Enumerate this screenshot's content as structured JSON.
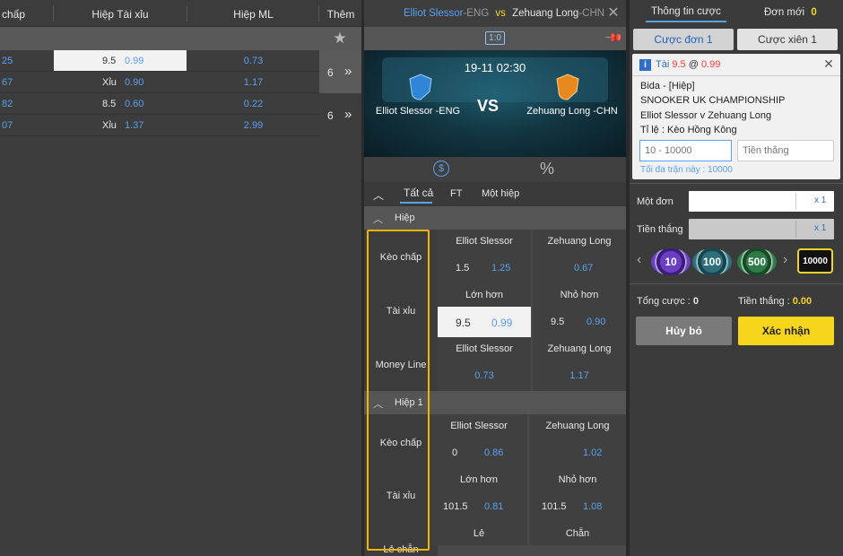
{
  "left": {
    "headers": {
      "col1": "chấp",
      "col2": "Hiệp Tài xỉu",
      "col3": "Hiệp ML",
      "col4": "Thêm"
    },
    "rows": [
      {
        "c1": "25",
        "c2a": "9.5",
        "c2b": "0.99",
        "c3": "0.73"
      },
      {
        "c1": "67",
        "c2a": "Xỉu",
        "c2b": "0.90",
        "c3": "1.17"
      },
      {
        "c1": "82",
        "c2a": "8.5",
        "c2b": "0.60",
        "c3": "0.22"
      },
      {
        "c1": "07",
        "c2a": "Xỉu",
        "c2b": "1.37",
        "c3": "2.99"
      }
    ],
    "more_count_1": "6",
    "more_count_2": "6",
    "more_arrow": "»"
  },
  "match": {
    "team1": "Elliot Slessor",
    "team1_country": "-ENG",
    "vs": "vs",
    "team2": "Zehuang Long",
    "team2_country": "-CHN",
    "score_badge": "1:0",
    "datetime": "19-11 02:30",
    "vs_big": "VS",
    "tabs": [
      "Tất cả",
      "FT",
      "Một hiệp"
    ],
    "section1": "Hiệp",
    "section2": "Hiệp 1"
  },
  "market": {
    "labels": [
      "Kèo chấp",
      "Tài xỉu",
      "Money Line",
      "Kèo chấp",
      "Tài xỉu",
      "Lẻ chẵn"
    ],
    "h_hdr1": "Elliot Slessor",
    "h_hdr2": "Zehuang Long",
    "h_a1": "1.5",
    "h_a2": "1.25",
    "h_b": "0.67",
    "ou_hdr1": "Lớn hơn",
    "ou_hdr2": "Nhỏ hơn",
    "ou_a1": "9.5",
    "ou_a2": "0.99",
    "ou_b1": "9.5",
    "ou_b2": "0.90",
    "ml_hdr1": "Elliot Slessor",
    "ml_hdr2": "Zehuang Long",
    "ml_a": "0.73",
    "ml_b": "1.17",
    "h1_hdr1": "Elliot Slessor",
    "h1_hdr2": "Zehuang Long",
    "h1_a1": "0",
    "h1_a2": "0.86",
    "h1_b": "1.02",
    "h1ou_hdr1": "Lớn hơn",
    "h1ou_hdr2": "Nhỏ hơn",
    "h1ou_a1": "101.5",
    "h1ou_a2": "0.81",
    "h1ou_b1": "101.5",
    "h1ou_b2": "1.08",
    "oe_hdr1": "Lẻ",
    "oe_hdr2": "Chẵn"
  },
  "slip": {
    "tab_info": "Thông tin cược",
    "tab_new": "Đơn mới",
    "new_count": "0",
    "single": "Cược đơn 1",
    "parlay": "Cược xiên 1",
    "bet_pick": "Tài",
    "bet_line": "9.5",
    "bet_at": "@",
    "bet_odds": "0.99",
    "sport": "Bida - [Hiệp]",
    "league": "SNOOKER UK CHAMPIONSHIP",
    "match": "Elliot Slessor v Zehuang Long",
    "odds_type": "Tỉ lệ : Kèo Hồng Kông",
    "stake_placeholder": "10 - 10000",
    "win_placeholder": "Tiền thắng",
    "max_note": "Tối đa trận này : 10000",
    "single_label": "Một đơn",
    "single_mult": "x 1",
    "win_label": "Tiền thắng",
    "win_mult": "x 1",
    "chips": [
      "10",
      "100",
      "500",
      "10000"
    ],
    "total_label": "Tổng cược :",
    "total_value": "0",
    "win_total_label": "Tiền thắng :",
    "win_total_value": "0.00",
    "cancel": "Hủy bỏ",
    "confirm": "Xác nhận"
  },
  "colors": {
    "accent": "#f5d328",
    "blue": "#5aa0ee",
    "red": "#ff3b2f"
  }
}
